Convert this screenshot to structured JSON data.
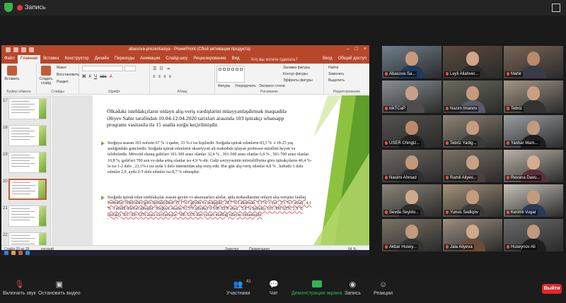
{
  "zoom_top": {
    "recording_label": "Запись"
  },
  "ppt": {
    "title": "abasova-prezentasiya - PowerPoint (Сбой активации продукта)",
    "tabs": [
      "Файл",
      "Главная",
      "Вставка",
      "Конструктор",
      "Дизайн",
      "Переходы",
      "Анимация",
      "Слайд-шоу",
      "Рецензирование",
      "Вид"
    ],
    "active_tab": "Главная",
    "tell_me": "Что вы хотите сделать?",
    "sign_in": "Вход",
    "share": "Общий доступ",
    "ribbon": {
      "clipboard_label": "Буфер обмена",
      "paste": "Вставить",
      "create_slide": "Создать слайд",
      "layout": "Макет",
      "restore": "Восстановить",
      "section": "Раздел",
      "slides_label": "Слайды",
      "font_label": "Шрифт",
      "paragraph_label": "Абзац",
      "shapes": "Фигуры",
      "arrange": "Упорядочить",
      "quick_styles": "Экспресс-стили",
      "fill": "Заливка фигуры",
      "outline": "Контур фигуры",
      "effects": "Эффекты фигуры",
      "drawing_label": "Рисование",
      "find": "Найти",
      "replace": "Заменить",
      "select": "Выделить",
      "editing_label": "Редактирование"
    },
    "thumbs": [
      {
        "num": "17"
      },
      {
        "num": "18"
      },
      {
        "num": "19"
      },
      {
        "num": "20"
      },
      {
        "num": "21"
      },
      {
        "num": "22"
      },
      {
        "num": "23"
      }
    ],
    "slide": {
      "title": "Ölkədəki istehlakçıların onlayn alış-veriş vərdişlərini müəyyənləşdirmək məqsədilə Əliyev Sabir tərəfindən 10.04-12.04.2020 tarixləri arasında 103 iştirakçı whatsapp proqramı vasitəsilə ilə 15 sualla sorğu keçirilmişdir.",
      "bullet1": "Sorğuya əsasən 103 nəfərin 67 % -i qadın, 33 %-i isə kişilərdir. Sorğuda iştirak edənlərin 83,3 % -i 18-25 yaş aralığındakı gənclərdir. Sorğuda iştirak edənlərin əksəriyyəti ali məktəbdə işləyən professor-müəllim heyəti və tələbələrdir. Mövcüd olanıq gəlirləri 101-300 arası olanlar 32,4 % , 301-500 arası olanlar 6,9 % , 501-700 arası olanlar 10,8 %, gəlirləri 700 azn və daha artıq olanlar isə 4,9 %-dir. Gəlir səviyyəsinin müxtəlifliyinə görə iştirakçıların 40,4 %-lə isə 1-2 dəfə , 23,1%-i isə ayda 1 dəfə internetdən alış-veriş edir. Hər gün alış-veriş edənlər 4,8 % , həftədə 1 dəfə edənlər 2,9, ayda 2-3 dəfə edənlər isə 8,7 % olmuşdur.",
      "bullet2": "Sorğuda iştirak edən istehlakçılar əsasən geyim və aksesuarları alırlar, qida məhsullarının onlayn alış-verişinə fəallıq vermirlər. Nəticələrə görə iştirakçıların 35,1 %-i geyim və ayaqqabı, 24,7 %-i aksesuar, 3,1 % -i yar , 2,1 %-i ərzaq , 4,1 % -i mobil telefon almışdır. Sorğuya əsasən 91,3% iştirakçı 0-100 AZN arası , 5,8 % iştirakçı 101-300 AZN, 2,9 % iştirakçı 301-300 AZN arası xərcləmişlər. 500 AZN-dən yuxarı məbləğ ödəyən olmamışdır."
    },
    "status": {
      "slide_info": "Слайд 20 из 35",
      "language": "русский",
      "notes": "Заметки",
      "comments": "Примечания",
      "zoom": "64 %"
    }
  },
  "participants": [
    {
      "name": "Abasova Sa...",
      "muted": true,
      "bg": "#6f7f8c",
      "skin": "#c99a7a",
      "cloth": "#1f3a5a"
    },
    {
      "name": "Leyli Allahver...",
      "muted": true,
      "bg": "#5c4a3e",
      "skin": "#d0a588",
      "cloth": "#2b2b2b"
    },
    {
      "name": "Mahir",
      "muted": true,
      "bg": "#7a6555",
      "skin": "#b98a6a",
      "cloth": "#3a3a4a"
    },
    {
      "name": "nikTCaP",
      "muted": true,
      "bg": "#8a8f94",
      "skin": "#c7a089",
      "cloth": "#4d4d4d"
    },
    {
      "name": "Nazim Imanov",
      "muted": true,
      "bg": "#6a6a5e",
      "skin": "#c79a7b",
      "cloth": "#5a5a6a"
    },
    {
      "name": "Tebriz",
      "muted": true,
      "bg": "#a39786",
      "skin": "#caa083",
      "cloth": "#333"
    },
    {
      "name": "USER Chingiz...",
      "muted": true,
      "bg": "#55524e",
      "skin": "#b98a6d",
      "cloth": "#222"
    },
    {
      "name": "Tebriz Yadig...",
      "muted": true,
      "bg": "#8d8475",
      "skin": "#c79d80",
      "cloth": "#3b3b3b"
    },
    {
      "name": "Yashar Mam...",
      "muted": true,
      "bg": "#9aa0a3",
      "skin": "#c49a7f",
      "cloth": "#1e1e1e"
    },
    {
      "name": "Nasimi Ahmad",
      "muted": true,
      "bg": "#6e6a64",
      "skin": "#c39879",
      "cloth": "#2e2e2e"
    },
    {
      "name": "Ramil Aliyev...",
      "muted": true,
      "bg": "#7b7367",
      "skin": "#c9a184",
      "cloth": "#4b4040"
    },
    {
      "name": "Revana Davu...",
      "muted": true,
      "bg": "#b9b3a8",
      "skin": "#d4ad90",
      "cloth": "#5a2f3a"
    },
    {
      "name": "Sevda Seyido...",
      "muted": true,
      "bg": "#8b847a",
      "skin": "#cfa98c",
      "cloth": "#2c2c2c"
    },
    {
      "name": "Yunus Sadiqov",
      "muted": true,
      "bg": "#a4927b",
      "skin": "#c59b7d",
      "cloth": "#3a3a3a"
    },
    {
      "name": "Kerimli Vugar",
      "muted": true,
      "bg": "#c7c2b8",
      "skin": "#c39a7c",
      "cloth": "#2a3a5a"
    },
    {
      "name": "Akbar Husey...",
      "muted": true,
      "bg": "#7b7466",
      "skin": "#c4997b",
      "cloth": "#333"
    },
    {
      "name": "Jala Aliyeva",
      "muted": true,
      "bg": "#9b8f80",
      "skin": "#d1a88b",
      "cloth": "#6b4c3a"
    },
    {
      "name": "Huseynov Ali",
      "muted": true,
      "bg": "#6a6a6a",
      "skin": "#c2987a",
      "cloth": "#1e1e1e"
    }
  ],
  "toolbar": {
    "mute": "Включить звук",
    "video": "Остановить видео",
    "participants": "Участники",
    "participants_count": "41",
    "chat": "Чат",
    "share": "Демонстрация экрана",
    "record": "Запись",
    "reactions": "Реакции",
    "leave": "Выйти"
  },
  "colors": {
    "ppt_accent": "#b7472a",
    "share_green": "#2db552",
    "leave_red": "#e02828",
    "active_speaker": "#9bd34a"
  }
}
